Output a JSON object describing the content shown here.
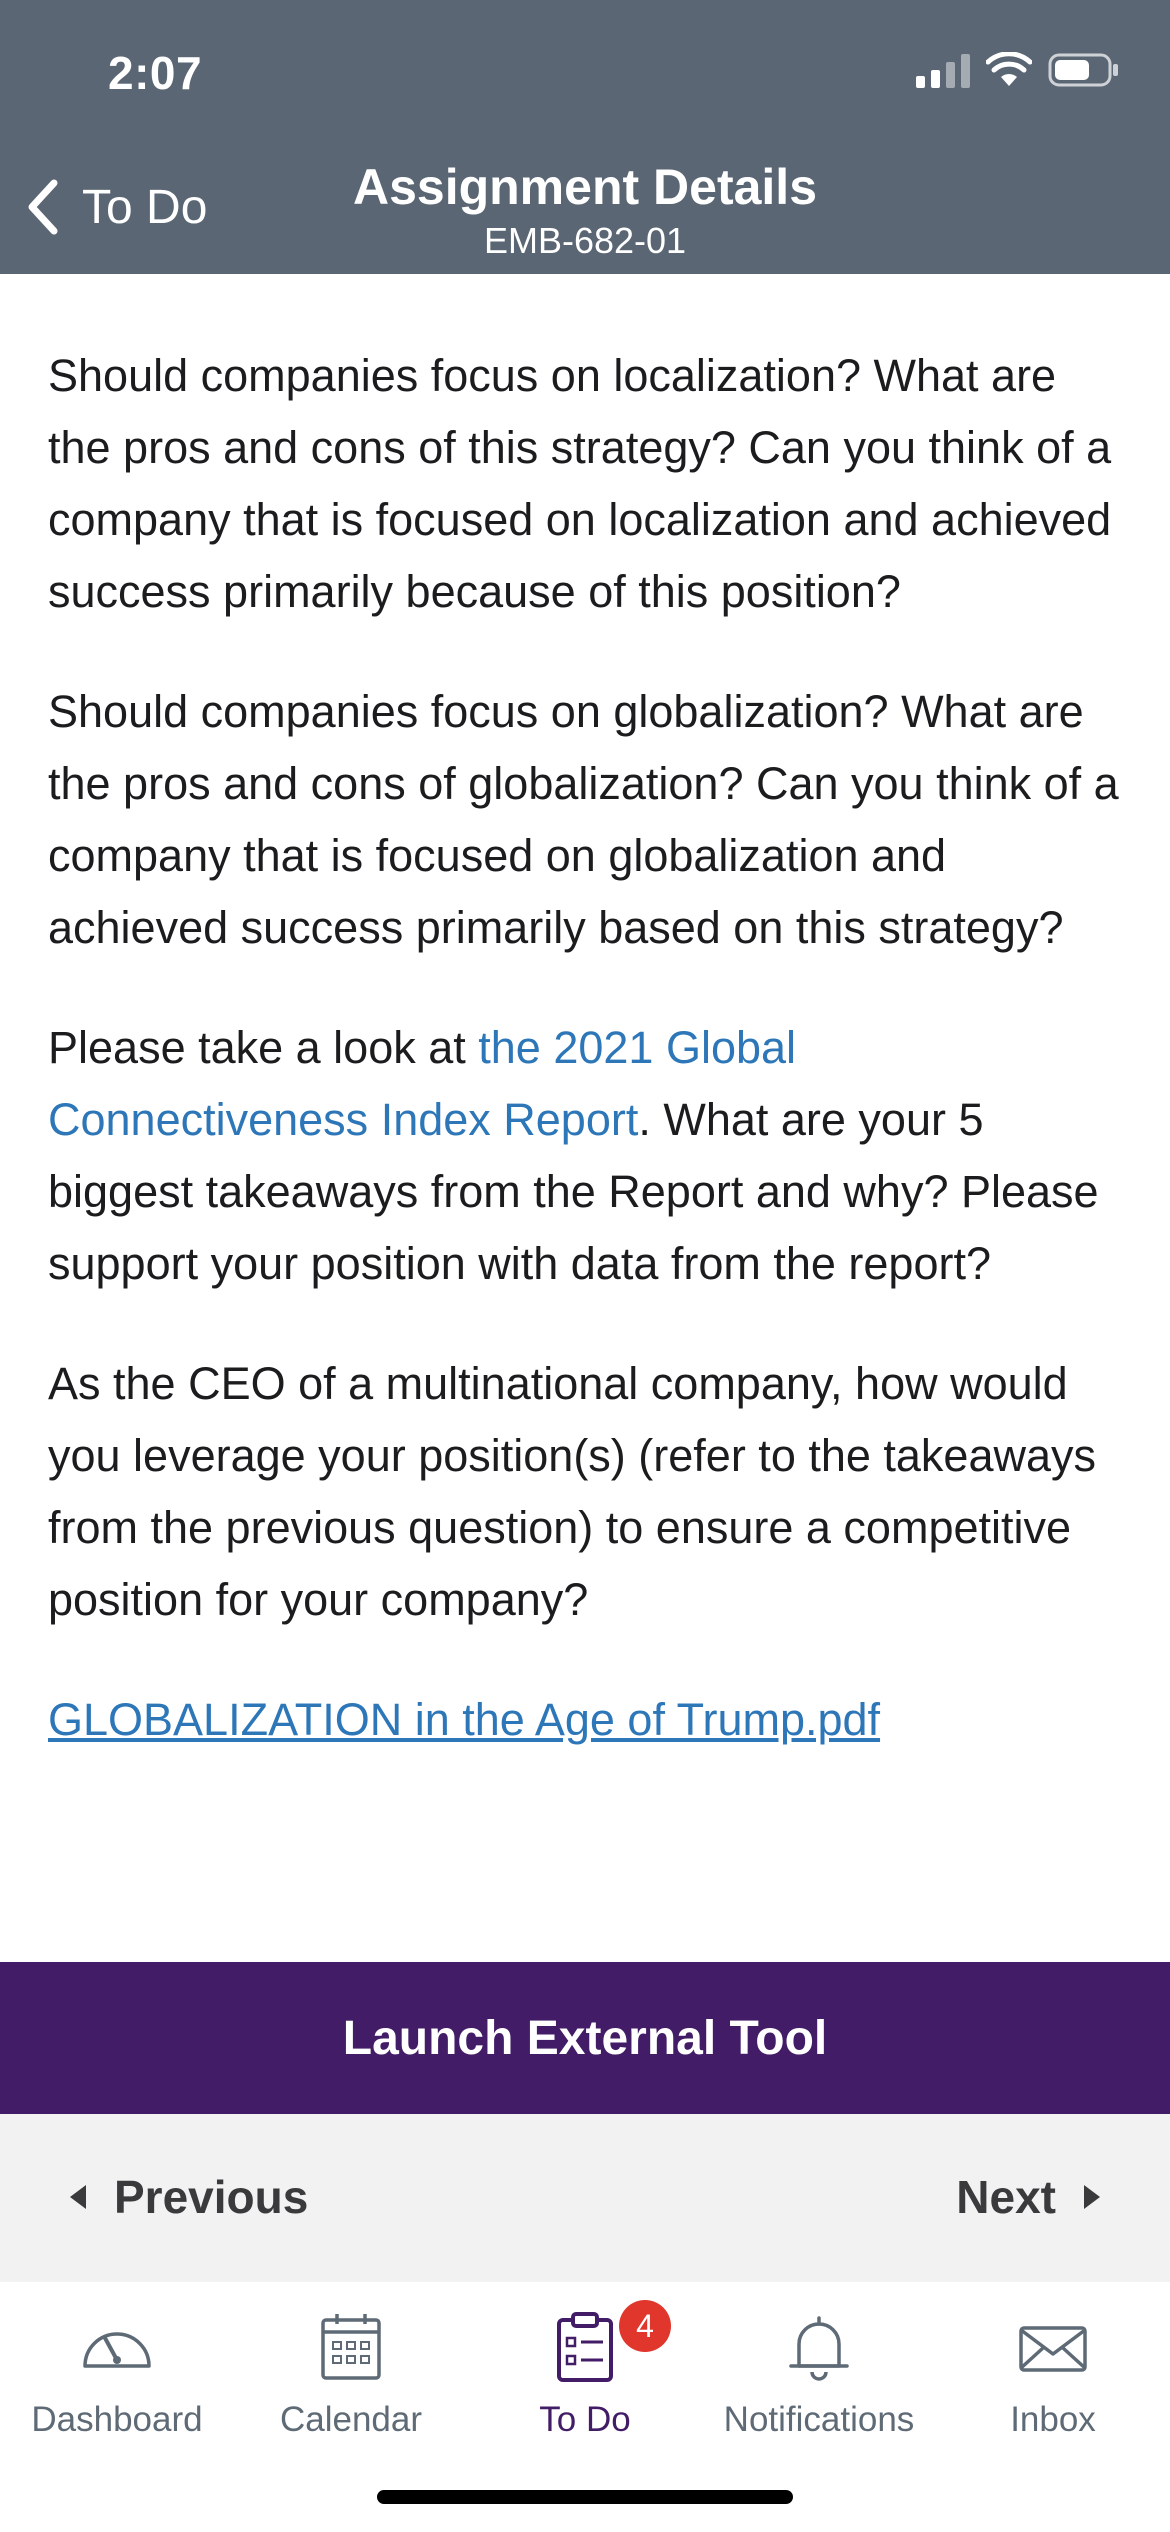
{
  "status_bar": {
    "time": "2:07"
  },
  "nav": {
    "back_label": "To Do",
    "title": "Assignment Details",
    "subtitle": "EMB-682-01"
  },
  "content": {
    "paragraph_1": "Should companies focus on localization?  What are the pros and cons of this strategy? Can you think of a company that is focused on localization and achieved success primarily because of this position?",
    "paragraph_2": "Should companies focus on globalization?  What are the pros and cons of globalization? Can you think of a company that is focused on globalization and achieved success primarily based on this strategy?",
    "paragraph_3_prefix": "Please take a look at ",
    "paragraph_3_link": "the 2021 Global Connectiveness Index Report",
    "paragraph_3_suffix": ".  What are your 5 biggest takeaways from the Report and why? Please support your position with data from the report?",
    "paragraph_4": "As the CEO of a multinational company, how would you leverage your position(s) (refer to the takeaways from the previous question) to ensure a competitive position for your company?",
    "attachment_link": "GLOBALIZATION in the Age of Trump.pdf"
  },
  "launch_button": "Launch External Tool",
  "pager": {
    "previous": "Previous",
    "next": "Next"
  },
  "tabbar": {
    "items": [
      {
        "label": "Dashboard",
        "icon": "dashboard-gauge-icon"
      },
      {
        "label": "Calendar",
        "icon": "calendar-icon"
      },
      {
        "label": "To Do",
        "icon": "todo-clipboard-icon",
        "badge": "4",
        "active": true
      },
      {
        "label": "Notifications",
        "icon": "bell-icon"
      },
      {
        "label": "Inbox",
        "icon": "envelope-icon"
      }
    ]
  },
  "colors": {
    "header": "#5a6673",
    "accent_purple": "#421c66",
    "link_blue": "#2d77b8",
    "badge_red": "#e0362c"
  }
}
